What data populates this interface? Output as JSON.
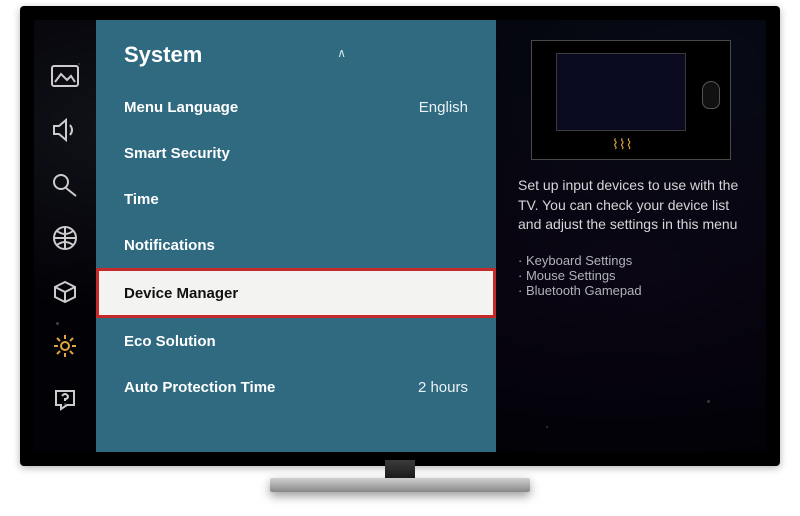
{
  "panel": {
    "title": "System",
    "scroll": "more-above"
  },
  "menu": {
    "items": [
      {
        "label": "Menu Language",
        "value": "English",
        "selected": false
      },
      {
        "label": "Smart Security",
        "value": "",
        "selected": false
      },
      {
        "label": "Time",
        "value": "",
        "selected": false
      },
      {
        "label": "Notifications",
        "value": "",
        "selected": false
      },
      {
        "label": "Device Manager",
        "value": "",
        "selected": true
      },
      {
        "label": "Eco Solution",
        "value": "",
        "selected": false
      },
      {
        "label": "Auto Protection Time",
        "value": "2 hours",
        "selected": false
      }
    ]
  },
  "rail": {
    "icons": [
      "picture-icon",
      "sound-icon",
      "broadcast-icon",
      "network-icon",
      "smarthub-icon",
      "system-icon",
      "support-icon"
    ],
    "active_index": 5
  },
  "help": {
    "description": "Set up input devices to use with the TV. You can check your device list and adjust the settings in this menu",
    "sub_items": [
      "Keyboard Settings",
      "Mouse Settings",
      "Bluetooth Gamepad"
    ]
  }
}
